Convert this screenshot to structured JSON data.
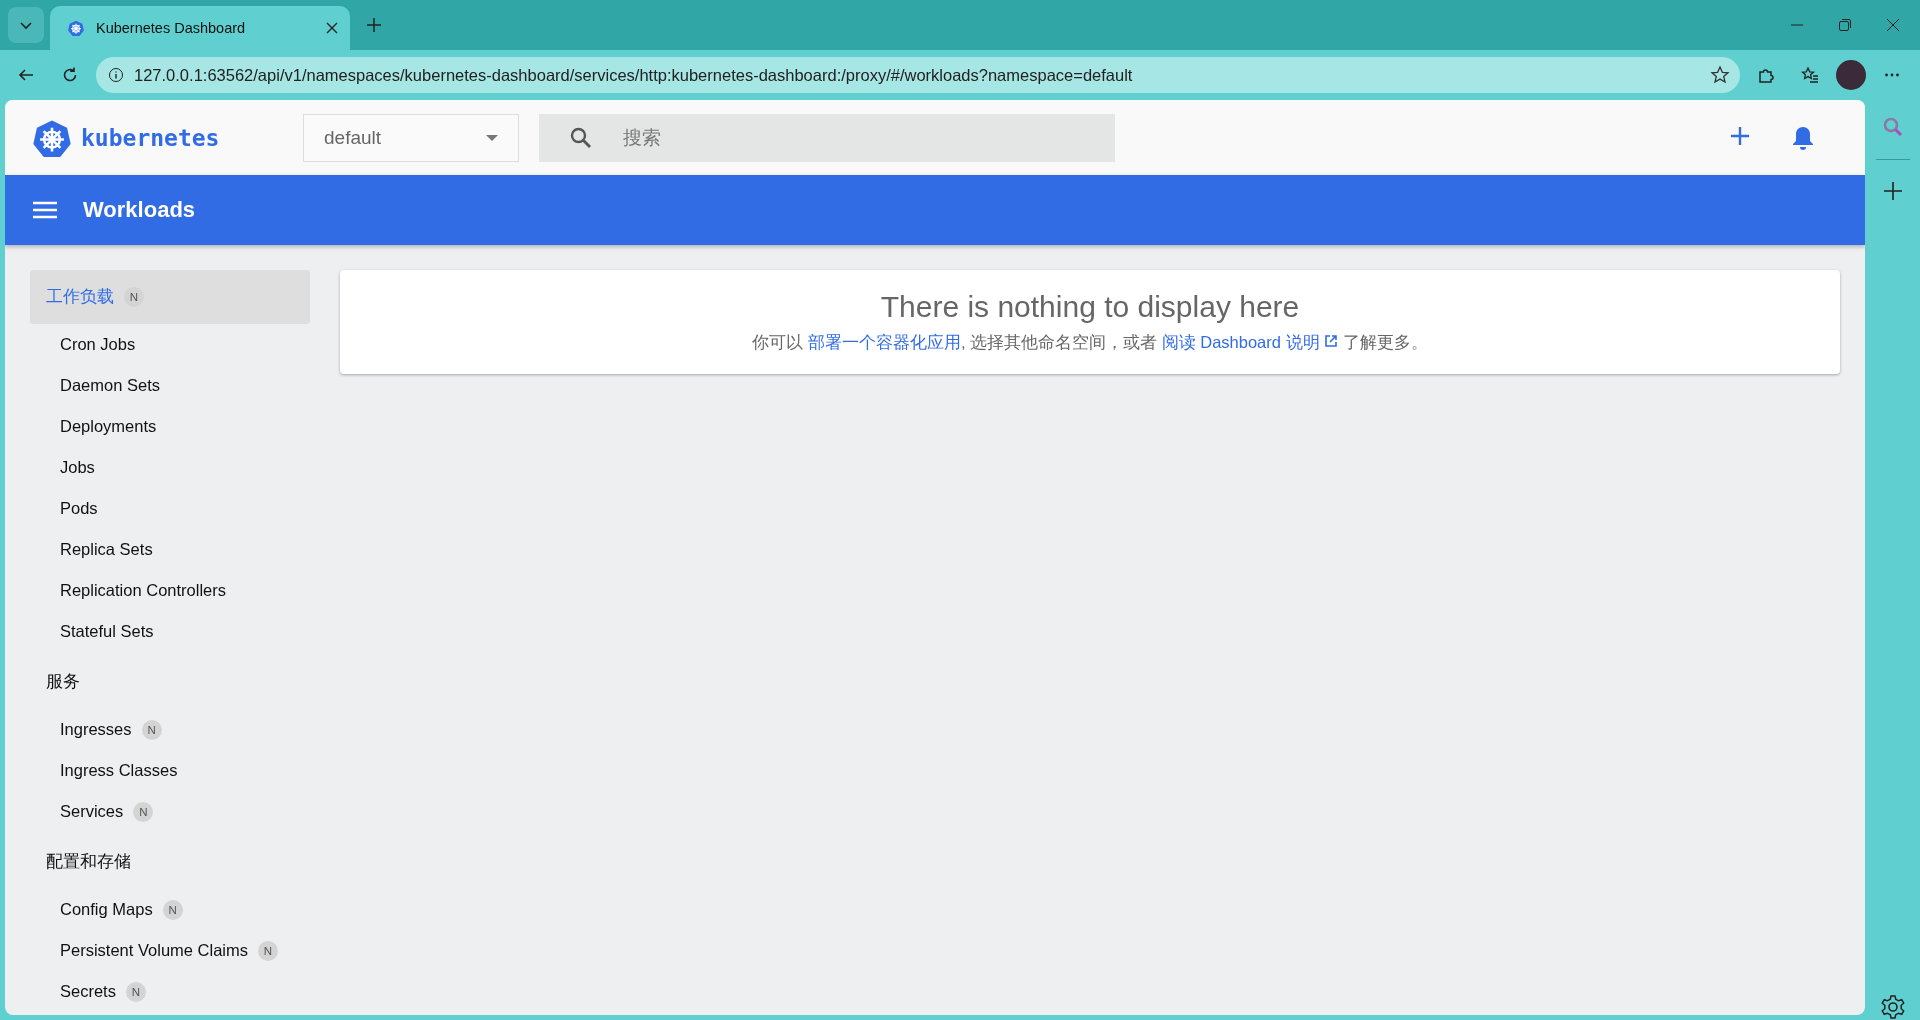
{
  "browser": {
    "tabs": [
      {
        "title": "Kubernetes Dashboard",
        "selected": true
      }
    ],
    "address": "127.0.0.1:63562/api/v1/namespaces/kubernetes-dashboard/services/http:kubernetes-dashboard:/proxy/#/workloads?namespace=default"
  },
  "header": {
    "logo": "kubernetes",
    "namespace": "default",
    "search": {
      "placeholder": "搜索"
    }
  },
  "toolbar": {
    "title": "Workloads"
  },
  "nav": [
    {
      "label": "工作负载",
      "badge": "N",
      "selected": true,
      "children": [
        {
          "label": "Cron Jobs",
          "selected": false
        },
        {
          "label": "Daemon Sets",
          "selected": false
        },
        {
          "label": "Deployments",
          "selected": false
        },
        {
          "label": "Jobs",
          "selected": false
        },
        {
          "label": "Pods",
          "selected": false
        },
        {
          "label": "Replica Sets",
          "selected": false
        },
        {
          "label": "Replication Controllers",
          "selected": false
        },
        {
          "label": "Stateful Sets",
          "selected": false
        }
      ]
    },
    {
      "label": "服务",
      "selected": false,
      "children": [
        {
          "label": "Ingresses",
          "badge": "N",
          "selected": false
        },
        {
          "label": "Ingress Classes",
          "selected": false
        },
        {
          "label": "Services",
          "badge": "N",
          "selected": false
        }
      ]
    },
    {
      "label": "配置和存储",
      "selected": false,
      "children": [
        {
          "label": "Config Maps",
          "badge": "N",
          "selected": false
        },
        {
          "label": "Persistent Volume Claims",
          "badge": "N",
          "selected": false
        },
        {
          "label": "Secrets",
          "badge": "N",
          "selected": false
        }
      ]
    }
  ],
  "empty_state": {
    "title": "There is nothing to display here",
    "message": [
      {
        "kind": "text",
        "text": "你可以 "
      },
      {
        "kind": "link",
        "text": "部署一个容器化应用"
      },
      {
        "kind": "text",
        "text": ", 选择其他命名空间，或者 "
      },
      {
        "kind": "external_link",
        "text": "阅读 Dashboard 说明"
      },
      {
        "kind": "text",
        "text": " 了解更多。"
      }
    ]
  }
}
